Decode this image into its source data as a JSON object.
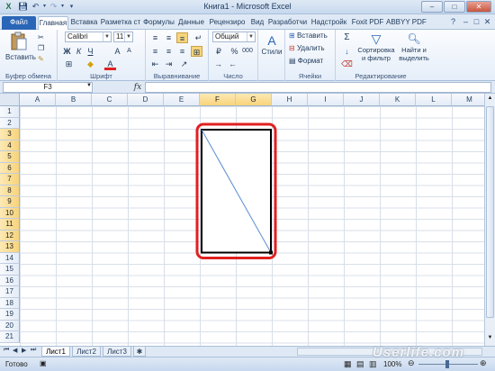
{
  "window": {
    "title": "Книга1  -  Microsoft Excel"
  },
  "tabs": {
    "file": "Файл",
    "items": [
      "Главная",
      "Вставка",
      "Разметка ст",
      "Формулы",
      "Данные",
      "Рецензиро",
      "Вид",
      "Разработчи",
      "Надстройк",
      "Foxit PDF",
      "ABBYY PDF T"
    ]
  },
  "ribbon": {
    "clipboard": {
      "paste": "Вставить",
      "label": "Буфер обмена"
    },
    "font": {
      "name": "Calibri",
      "size": "11",
      "label": "Шрифт",
      "bold": "Ж",
      "italic": "К",
      "underline": "Ч",
      "grow": "A",
      "shrink": "A",
      "color_letter": "A"
    },
    "alignment": {
      "label": "Выравнивание"
    },
    "number": {
      "format": "Общий",
      "label": "Число",
      "percent": "%",
      "thousands": "000"
    },
    "styles": {
      "label": "Стили"
    },
    "cells": {
      "insert": "Вставить",
      "delete": "Удалить",
      "format": "Формат",
      "label": "Ячейки"
    },
    "editing": {
      "sort": "Сортировка\nи фильтр",
      "sort_l1": "Сортировка",
      "sort_l2": "и фильтр",
      "find_l1": "Найти и",
      "find_l2": "выделить",
      "label": "Редактирование",
      "sigma": "Σ"
    }
  },
  "formula_bar": {
    "name_box": "F3",
    "fx": "fx",
    "value": ""
  },
  "grid": {
    "columns": [
      "A",
      "B",
      "C",
      "D",
      "E",
      "F",
      "G",
      "H",
      "I",
      "J",
      "K",
      "L",
      "M"
    ],
    "selected_columns": [
      "F",
      "G"
    ],
    "rows": [
      "1",
      "2",
      "3",
      "4",
      "5",
      "6",
      "7",
      "8",
      "9",
      "10",
      "11",
      "12",
      "13",
      "14",
      "15",
      "16",
      "17",
      "18",
      "19",
      "20",
      "21"
    ],
    "selected_rows": [
      "3",
      "4",
      "5",
      "6",
      "7",
      "8",
      "9",
      "10",
      "11",
      "12",
      "13"
    ]
  },
  "sheets": {
    "items": [
      "Лист1",
      "Лист2",
      "Лист3"
    ],
    "active": "Лист1"
  },
  "status": {
    "ready": "Готово",
    "zoom": "100%"
  },
  "watermark": "Userlife.com",
  "colors": {
    "accent": "#2a66b7",
    "highlight": "#e02020",
    "selection": "#f8d47a"
  }
}
